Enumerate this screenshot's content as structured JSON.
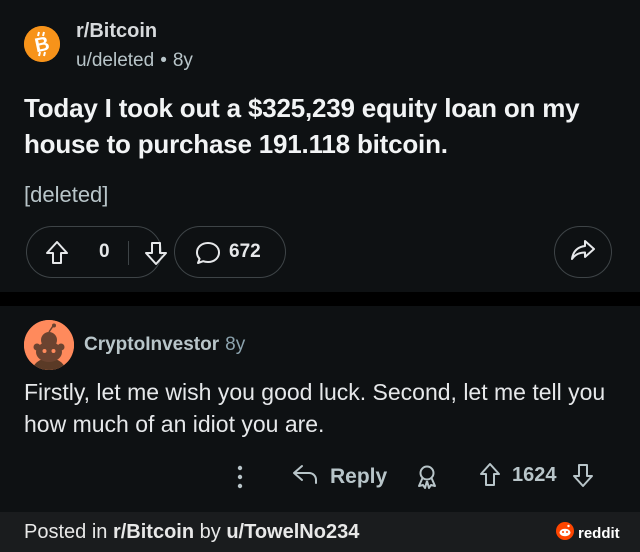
{
  "post": {
    "subreddit": "r/Bitcoin",
    "author": "u/deleted",
    "separator": "•",
    "age": "8y",
    "title": "Today I took out a $325,239 equity loan on my house to purchase 191.118 bitcoin.",
    "body": "[deleted]",
    "score": "0",
    "comment_count": "672",
    "icons": [
      "bitcoin-logo-icon",
      "upvote-arrow-icon",
      "downvote-arrow-icon",
      "comment-bubble-icon",
      "share-arrow-icon"
    ]
  },
  "comment": {
    "author": "CryptoInvestor",
    "age": "8y",
    "text": "Firstly, let me wish you good luck. Second, let me tell you how much of an idiot you are.",
    "reply_label": "Reply",
    "score": "1624",
    "icons": [
      "more-options-icon",
      "reply-arrow-icon",
      "award-icon",
      "upvote-arrow-icon",
      "downvote-arrow-icon"
    ]
  },
  "footer": {
    "prefix": "Posted in ",
    "subreddit": "r/Bitcoin",
    "middle": " by ",
    "user": "u/TowelNo234",
    "brand": "reddit"
  },
  "colors": {
    "background": "#0e1113",
    "bitcoin_orange": "#f7931a",
    "avatar_orange": "#ff8a5c",
    "footer_background": "#1a1c1e"
  }
}
